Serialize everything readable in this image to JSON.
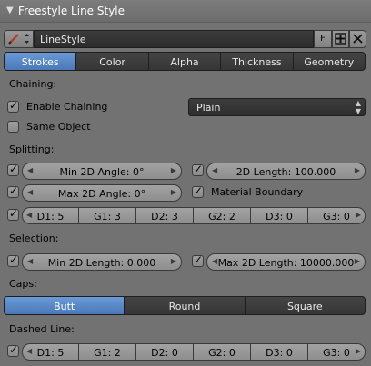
{
  "panel": {
    "title": "Freestyle Line Style"
  },
  "linestyle": {
    "name": "LineStyle",
    "fake_user": "F"
  },
  "tabs": [
    {
      "label": "Strokes",
      "active": true
    },
    {
      "label": "Color",
      "active": false
    },
    {
      "label": "Alpha",
      "active": false
    },
    {
      "label": "Thickness",
      "active": false
    },
    {
      "label": "Geometry",
      "active": false
    }
  ],
  "chaining": {
    "heading": "Chaining:",
    "enable_label": "Enable Chaining",
    "enable_checked": true,
    "method": "Plain",
    "same_object_label": "Same Object",
    "same_object_checked": false
  },
  "splitting": {
    "heading": "Splitting:",
    "min_angle": "Min 2D Angle: 0°",
    "min_angle_checked": true,
    "max_angle": "Max 2D Angle: 0°",
    "max_angle_checked": true,
    "length_2d": "2D Length: 100.000",
    "length_2d_checked": true,
    "material_boundary_label": "Material Boundary",
    "material_boundary_checked": true,
    "dash_checked": true,
    "dashes": [
      "D1: 5",
      "G1: 3",
      "D2: 3",
      "G2: 2",
      "D3: 0",
      "G3: 0"
    ]
  },
  "selection": {
    "heading": "Selection:",
    "min_length": "Min 2D Length: 0.000",
    "min_length_checked": true,
    "max_length": "Max 2D Length: 10000.000",
    "max_length_checked": true
  },
  "caps": {
    "heading": "Caps:",
    "options": [
      {
        "label": "Butt",
        "active": true
      },
      {
        "label": "Round",
        "active": false
      },
      {
        "label": "Square",
        "active": false
      }
    ]
  },
  "dashed_line": {
    "heading": "Dashed Line:",
    "checked": true,
    "dashes": [
      "D1: 5",
      "G1: 2",
      "D2: 0",
      "G2: 0",
      "D3: 0",
      "G3: 0"
    ]
  },
  "colors": {
    "accent": "#5a88c8",
    "panel_bg": "#727272",
    "field_dark": "#363636"
  }
}
